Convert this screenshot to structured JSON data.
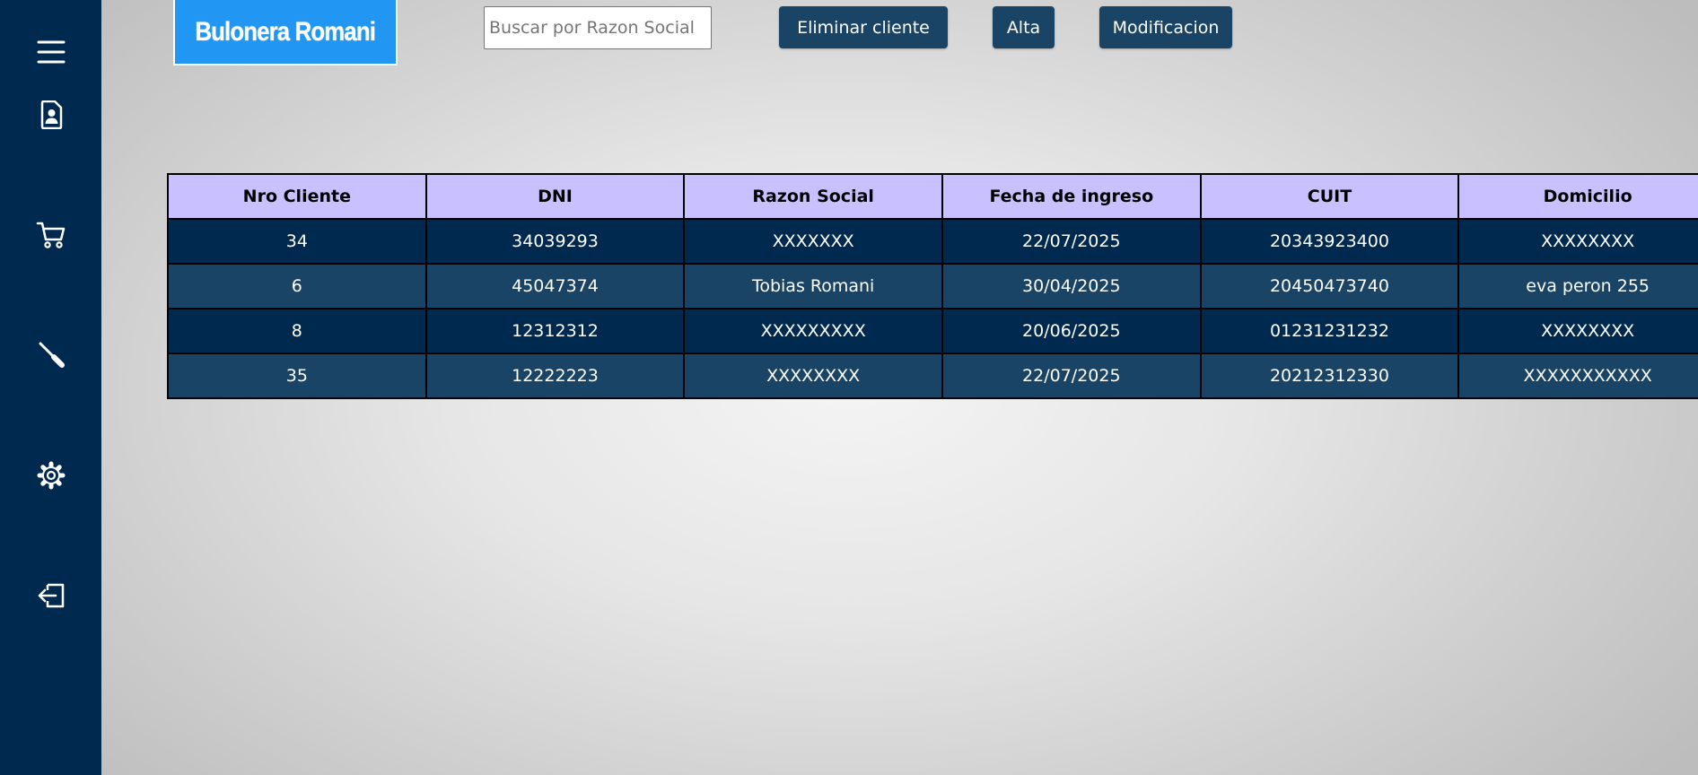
{
  "brand": {
    "title": "Bulonera Romani",
    "logo_color": "#2196f3",
    "sidebar_color": "#00294f"
  },
  "sidebar": {
    "items": [
      {
        "icon": "menu-icon"
      },
      {
        "icon": "client-file-icon"
      },
      {
        "icon": "cart-icon"
      },
      {
        "icon": "tool-icon"
      },
      {
        "icon": "gear-icon"
      },
      {
        "icon": "logout-icon"
      }
    ]
  },
  "toolbar": {
    "search_placeholder": "Buscar por Razon Social",
    "delete_label": "Eliminar cliente",
    "add_label": "Alta",
    "edit_label": "Modificacion",
    "button_color": "#1a4466"
  },
  "table": {
    "header_color": "#c9c0ff",
    "columns": [
      "Nro Cliente",
      "DNI",
      "Razon Social",
      "Fecha de ingreso",
      "CUIT",
      "Domicilio"
    ],
    "rows": [
      [
        "34",
        "34039293",
        "XXXXXXX",
        "22/07/2025",
        "20343923400",
        "XXXXXXXX"
      ],
      [
        "6",
        "45047374",
        "Tobias Romani",
        "30/04/2025",
        "20450473740",
        "eva peron 255"
      ],
      [
        "8",
        "12312312",
        "XXXXXXXXX",
        "20/06/2025",
        "01231231232",
        "XXXXXXXX"
      ],
      [
        "35",
        "12222223",
        "XXXXXXXX",
        "22/07/2025",
        "20212312330",
        "XXXXXXXXXXX"
      ]
    ]
  }
}
